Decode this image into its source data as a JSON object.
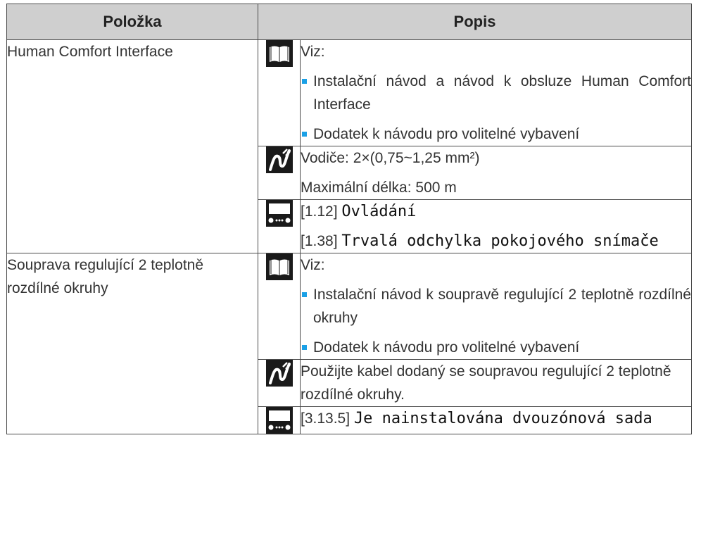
{
  "table": {
    "headers": {
      "item": "Položka",
      "description": "Popis"
    },
    "rows": [
      {
        "item": "Human Comfort Interface",
        "blocks": [
          {
            "icon": "book-icon",
            "intro": "Viz:",
            "bullets": [
              "Instalační návod a návod k obsluze Human Comfort Interface",
              "Dodatek k návodu pro volitelné vybavení"
            ]
          },
          {
            "icon": "cable-icon",
            "lines": [
              "Vodiče: 2×(0,75~1,25 mm²)",
              "Maximální délka: 500 m"
            ]
          },
          {
            "icon": "controller-icon",
            "refs": [
              {
                "code": "[1.12]",
                "text": "Ovládání"
              },
              {
                "code": "[1.38]",
                "text": "Trvalá odchylka pokojového snímače"
              }
            ]
          }
        ]
      },
      {
        "item": "Souprava regulující 2 teplotně rozdílné okruhy",
        "blocks": [
          {
            "icon": "book-icon",
            "intro": "Viz:",
            "bullets": [
              "Instalační návod k soupravě regulující 2 teplotně rozdílné okruhy",
              "Dodatek k návodu pro volitelné vybavení"
            ]
          },
          {
            "icon": "cable-icon",
            "lines": [
              "Použijte kabel dodaný se soupravou regulující 2 teplotně rozdílné okruhy."
            ]
          },
          {
            "icon": "controller-icon",
            "refs": [
              {
                "code": "[3.13.5]",
                "text": "Je nainstalována dvouzónová sada"
              }
            ]
          }
        ]
      }
    ]
  },
  "colors": {
    "header_bg": "#cfcfcf",
    "bullet": "#1aa0e6",
    "border": "#4a4a4a"
  }
}
